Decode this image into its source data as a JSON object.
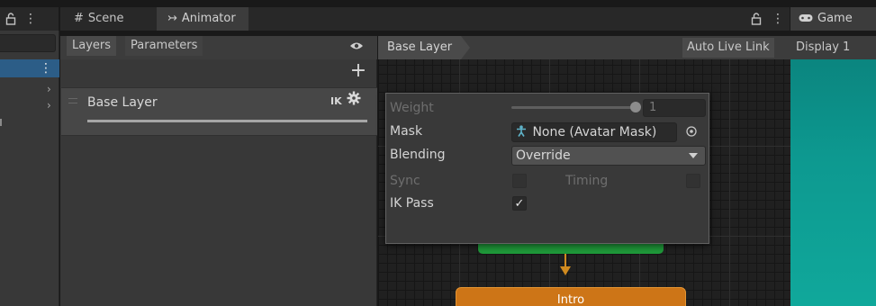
{
  "hierarchy": {
    "lock_icon": "lock-icon",
    "menu_icon": "kebab-menu-icon",
    "search_value": "",
    "selected_menu": "⋮",
    "expand_glyph": "›"
  },
  "tabs": {
    "scene": {
      "label": "Scene",
      "icon": "#"
    },
    "animator": {
      "label": "Animator",
      "icon": "↣"
    },
    "game": {
      "label": "Game",
      "icon": "gamepad-icon"
    }
  },
  "animator": {
    "layers_tab": "Layers",
    "parameters_tab": "Parameters",
    "add_glyph": "+",
    "layer": {
      "name": "Base Layer",
      "ik_label": "IK"
    },
    "breadcrumb": "Base Layer",
    "auto_live_link": "Auto Live Link",
    "intro_state": "Intro",
    "colors": {
      "entry_node": "#1f9a3a",
      "intro_node": "#cd7517",
      "transition": "#d08a1f"
    }
  },
  "layer_settings": {
    "weight_label": "Weight",
    "weight_value": "1",
    "weight_fraction": 1.0,
    "mask_label": "Mask",
    "mask_value": "None (Avatar Mask)",
    "blending_label": "Blending",
    "blending_value": "Override",
    "sync_label": "Sync",
    "timing_label": "Timing",
    "ik_pass_label": "IK Pass",
    "ik_pass_checked": true
  },
  "game": {
    "display": "Display 1",
    "background": "#0d9990"
  }
}
